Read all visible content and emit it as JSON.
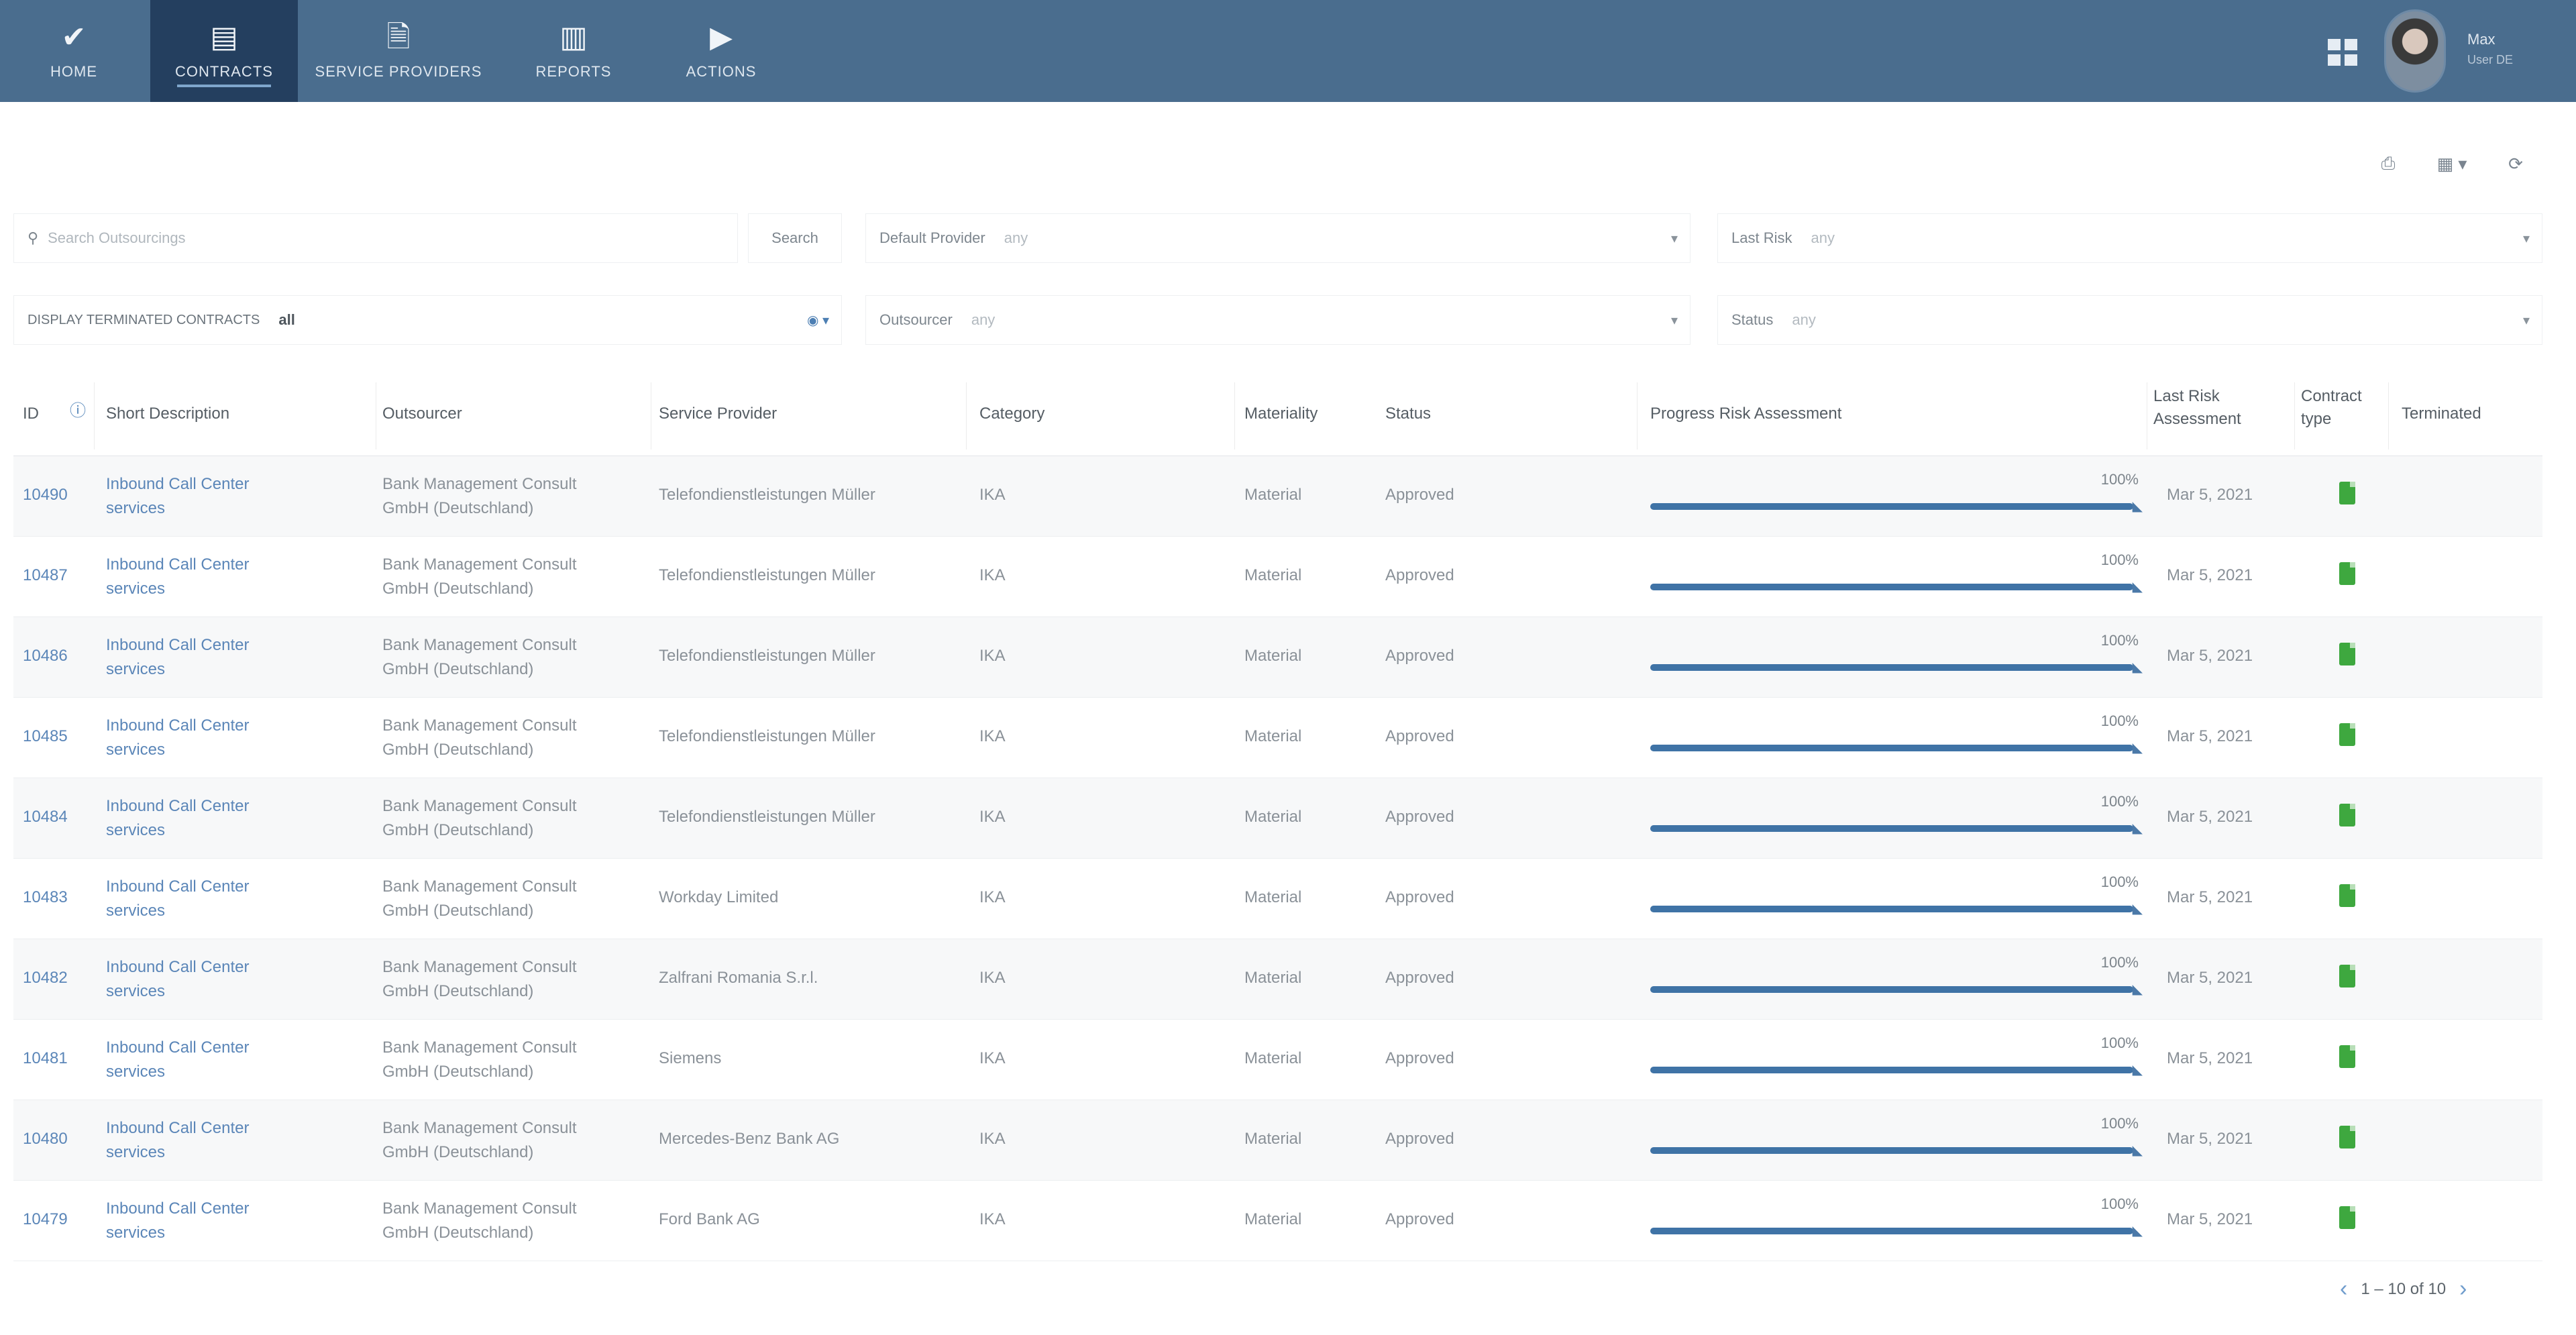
{
  "nav": {
    "items": [
      {
        "label": "HOME",
        "icon": "check-icon"
      },
      {
        "label": "CONTRACTS",
        "icon": "document-icon"
      },
      {
        "label": "SERVICE PROVIDERS",
        "icon": "file-icon"
      },
      {
        "label": "REPORTS",
        "icon": "chart-icon"
      },
      {
        "label": "ACTIONS",
        "icon": "play-icon"
      }
    ],
    "active": "CONTRACTS"
  },
  "user": {
    "name": "Max",
    "role": "User DE"
  },
  "filters": {
    "search_placeholder": "Search Outsourcings",
    "search_button": "Search",
    "default_provider": {
      "label": "Default Provider",
      "value": "any"
    },
    "last_risk": {
      "label": "Last Risk",
      "value": "any"
    },
    "display": {
      "label": "DISPLAY TERMINATED CONTRACTS",
      "value": "all"
    },
    "outsourcer": {
      "label": "Outsourcer",
      "value": "any"
    },
    "status": {
      "label": "Status",
      "value": "any"
    }
  },
  "table": {
    "headers": {
      "id": "ID",
      "short_description": "Short Description",
      "outsourcer": "Outsourcer",
      "service_provider": "Service Provider",
      "category": "Category",
      "materiality": "Materiality",
      "status": "Status",
      "progress": "Progress Risk Assessment",
      "last_risk_line1": "Last Risk",
      "last_risk_line2": "Assessment",
      "contract_line1": "Contract",
      "contract_line2": "type",
      "terminated": "Terminated"
    },
    "rows": [
      {
        "id": "10490",
        "desc1": "Inbound Call Center",
        "desc2": "services",
        "out1": "Bank Management Consult",
        "out2": "GmbH (Deutschland)",
        "provider": "Telefondienstleistungen Müller",
        "category": "IKA",
        "materiality": "Material",
        "status": "Approved",
        "progress_label": "100%",
        "progress": 1.0,
        "date": "Mar 5, 2021"
      },
      {
        "id": "10487",
        "desc1": "Inbound Call Center",
        "desc2": "services",
        "out1": "Bank Management Consult",
        "out2": "GmbH (Deutschland)",
        "provider": "Telefondienstleistungen Müller",
        "category": "IKA",
        "materiality": "Material",
        "status": "Approved",
        "progress_label": "100%",
        "progress": 1.0,
        "date": "Mar 5, 2021"
      },
      {
        "id": "10486",
        "desc1": "Inbound Call Center",
        "desc2": "services",
        "out1": "Bank Management Consult",
        "out2": "GmbH (Deutschland)",
        "provider": "Telefondienstleistungen Müller",
        "category": "IKA",
        "materiality": "Material",
        "status": "Approved",
        "progress_label": "100%",
        "progress": 1.0,
        "date": "Mar 5, 2021"
      },
      {
        "id": "10485",
        "desc1": "Inbound Call Center",
        "desc2": "services",
        "out1": "Bank Management Consult",
        "out2": "GmbH (Deutschland)",
        "provider": "Telefondienstleistungen Müller",
        "category": "IKA",
        "materiality": "Material",
        "status": "Approved",
        "progress_label": "100%",
        "progress": 1.0,
        "date": "Mar 5, 2021"
      },
      {
        "id": "10484",
        "desc1": "Inbound Call Center",
        "desc2": "services",
        "out1": "Bank Management Consult",
        "out2": "GmbH (Deutschland)",
        "provider": "Telefondienstleistungen Müller",
        "category": "IKA",
        "materiality": "Material",
        "status": "Approved",
        "progress_label": "100%",
        "progress": 1.0,
        "date": "Mar 5, 2021"
      },
      {
        "id": "10483",
        "desc1": "Inbound Call Center",
        "desc2": "services",
        "out1": "Bank Management Consult",
        "out2": "GmbH (Deutschland)",
        "provider": "Workday Limited",
        "category": "IKA",
        "materiality": "Material",
        "status": "Approved",
        "progress_label": "100%",
        "progress": 1.0,
        "date": "Mar 5, 2021"
      },
      {
        "id": "10482",
        "desc1": "Inbound Call Center",
        "desc2": "services",
        "out1": "Bank Management Consult",
        "out2": "GmbH (Deutschland)",
        "provider": "Zalfrani Romania S.r.l.",
        "category": "IKA",
        "materiality": "Material",
        "status": "Approved",
        "progress_label": "100%",
        "progress": 1.0,
        "date": "Mar 5, 2021"
      },
      {
        "id": "10481",
        "desc1": "Inbound Call Center",
        "desc2": "services",
        "out1": "Bank Management Consult",
        "out2": "GmbH (Deutschland)",
        "provider": "Siemens",
        "category": "IKA",
        "materiality": "Material",
        "status": "Approved",
        "progress_label": "100%",
        "progress": 1.0,
        "date": "Mar 5, 2021"
      },
      {
        "id": "10480",
        "desc1": "Inbound Call Center",
        "desc2": "services",
        "out1": "Bank Management Consult",
        "out2": "GmbH (Deutschland)",
        "provider": "Mercedes-Benz Bank AG",
        "category": "IKA",
        "materiality": "Material",
        "status": "Approved",
        "progress_label": "100%",
        "progress": 1.0,
        "date": "Mar 5, 2021"
      },
      {
        "id": "10479",
        "desc1": "Inbound Call Center",
        "desc2": "services",
        "out1": "Bank Management Consult",
        "out2": "GmbH (Deutschland)",
        "provider": "Ford Bank AG",
        "category": "IKA",
        "materiality": "Material",
        "status": "Approved",
        "progress_label": "100%",
        "progress": 1.0,
        "date": "Mar 5, 2021"
      }
    ]
  },
  "pagination": {
    "text": "1 – 10 of 10"
  },
  "colors": {
    "nav_bg": "#4a6d8e",
    "nav_active": "#243f5f",
    "progress": "#3f73a6",
    "contract_icon": "#3ea83f",
    "link": "#5b86b8"
  }
}
